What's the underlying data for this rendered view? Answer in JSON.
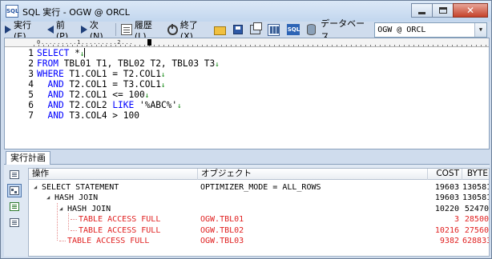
{
  "window": {
    "app_icon_text": "SQL",
    "title": "SQL 実行 - OGW @ ORCL"
  },
  "toolbar": {
    "execute_label": "実行(E)",
    "prev_label": "前(P)",
    "next_label": "次(N)",
    "history_label": "履歴(L)",
    "exit_label": "終了(X)",
    "sql_icon_text": "SQL",
    "database_label": "データベース",
    "database_value": "OGW @ ORCL"
  },
  "editor": {
    "ruler_text": "0.........1.........2...",
    "lines": [
      {
        "number": "1",
        "parts": [
          {
            "t": "SELECT",
            "k": "kw"
          },
          {
            "t": " *",
            "k": "code-text"
          },
          {
            "t": "↓",
            "k": "nl"
          }
        ]
      },
      {
        "number": "2",
        "parts": [
          {
            "t": "FROM",
            "k": "kw"
          },
          {
            "t": " TBL01 T1, TBL02 T2, TBL03 T3",
            "k": "code-text"
          },
          {
            "t": "↓",
            "k": "nl"
          }
        ]
      },
      {
        "number": "3",
        "parts": [
          {
            "t": "WHERE",
            "k": "kw"
          },
          {
            "t": " T1.COL1 = T2.COL1",
            "k": "code-text"
          },
          {
            "t": "↓",
            "k": "nl"
          }
        ]
      },
      {
        "number": "4",
        "parts": [
          {
            "t": "  AND",
            "k": "kw"
          },
          {
            "t": " T2.COL1 = T3.COL1",
            "k": "code-text"
          },
          {
            "t": "↓",
            "k": "nl"
          }
        ]
      },
      {
        "number": "5",
        "parts": [
          {
            "t": "  AND",
            "k": "kw"
          },
          {
            "t": " T2.COL1 <= 100",
            "k": "code-text"
          },
          {
            "t": "↓",
            "k": "nl"
          }
        ]
      },
      {
        "number": "6",
        "parts": [
          {
            "t": "  AND",
            "k": "kw"
          },
          {
            "t": " T2.COL2 ",
            "k": "code-text"
          },
          {
            "t": "LIKE",
            "k": "kw"
          },
          {
            "t": " '%ABC%'",
            "k": "code-text"
          },
          {
            "t": "↓",
            "k": "nl"
          }
        ]
      },
      {
        "number": "7",
        "parts": [
          {
            "t": "  AND",
            "k": "kw"
          },
          {
            "t": " T3.COL4 > 100",
            "k": "code-text"
          }
        ]
      }
    ]
  },
  "plan": {
    "tab_label": "実行計画",
    "columns": {
      "operation": "操作",
      "object": "オブジェクト",
      "cost": "COST",
      "byte": "BYTE"
    },
    "rows": [
      {
        "op": "SELECT STATEMENT",
        "object": "OPTIMIZER_MODE = ALL_ROWS",
        "cost": "19603",
        "byte": "130581",
        "red": false,
        "level": 0,
        "expand": true
      },
      {
        "op": "HASH JOIN",
        "object": "",
        "cost": "19603",
        "byte": "130581",
        "red": false,
        "level": 1,
        "expand": true
      },
      {
        "op": "HASH JOIN",
        "object": "",
        "cost": "10220",
        "byte": "52470",
        "red": false,
        "level": 2,
        "expand": true
      },
      {
        "op": "TABLE ACCESS FULL",
        "object": "OGW.TBL01",
        "cost": "3",
        "byte": "28500",
        "red": true,
        "level": 3,
        "expand": false
      },
      {
        "op": "TABLE ACCESS FULL",
        "object": "OGW.TBL02",
        "cost": "10216",
        "byte": "27560",
        "red": true,
        "level": 3,
        "expand": false
      },
      {
        "op": "TABLE ACCESS FULL",
        "object": "OGW.TBL03",
        "cost": "9382",
        "byte": "628833",
        "red": true,
        "level": 2,
        "expand": false
      }
    ]
  },
  "colors": {
    "keyword": "#0000ff",
    "line_break_mark": "#008000",
    "full_scan": "#e01f1f"
  }
}
